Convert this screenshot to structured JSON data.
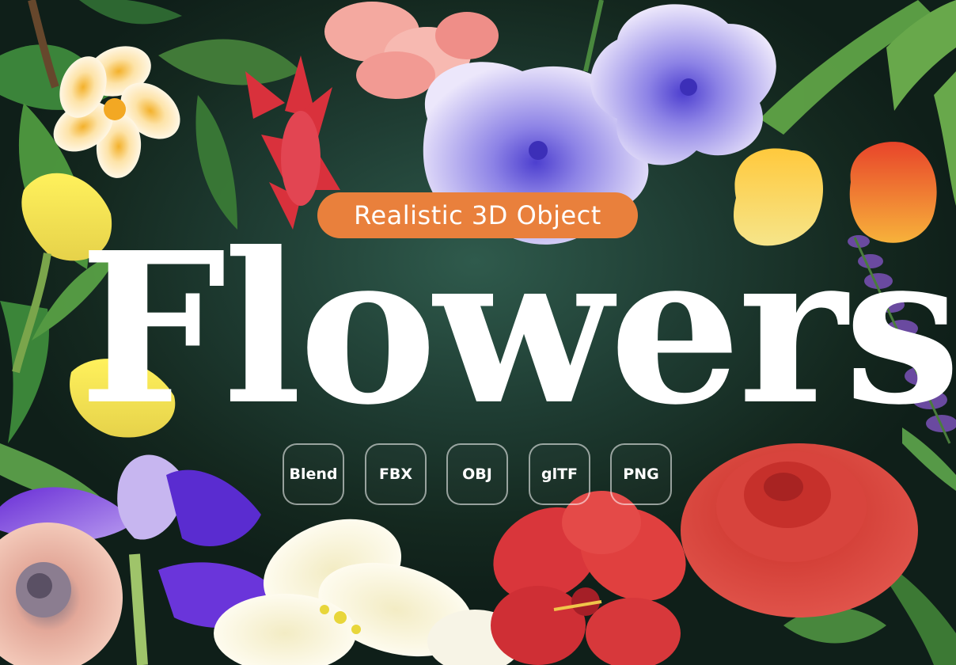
{
  "badge": {
    "text": "Realistic 3D Object"
  },
  "title": {
    "text": "Flowers"
  },
  "formats": [
    {
      "label": "Blend"
    },
    {
      "label": "FBX"
    },
    {
      "label": "OBJ"
    },
    {
      "label": "glTF"
    },
    {
      "label": "PNG"
    }
  ],
  "colors": {
    "background": "#1f3d33",
    "badge": "#e9803c",
    "title": "#ffffff"
  }
}
